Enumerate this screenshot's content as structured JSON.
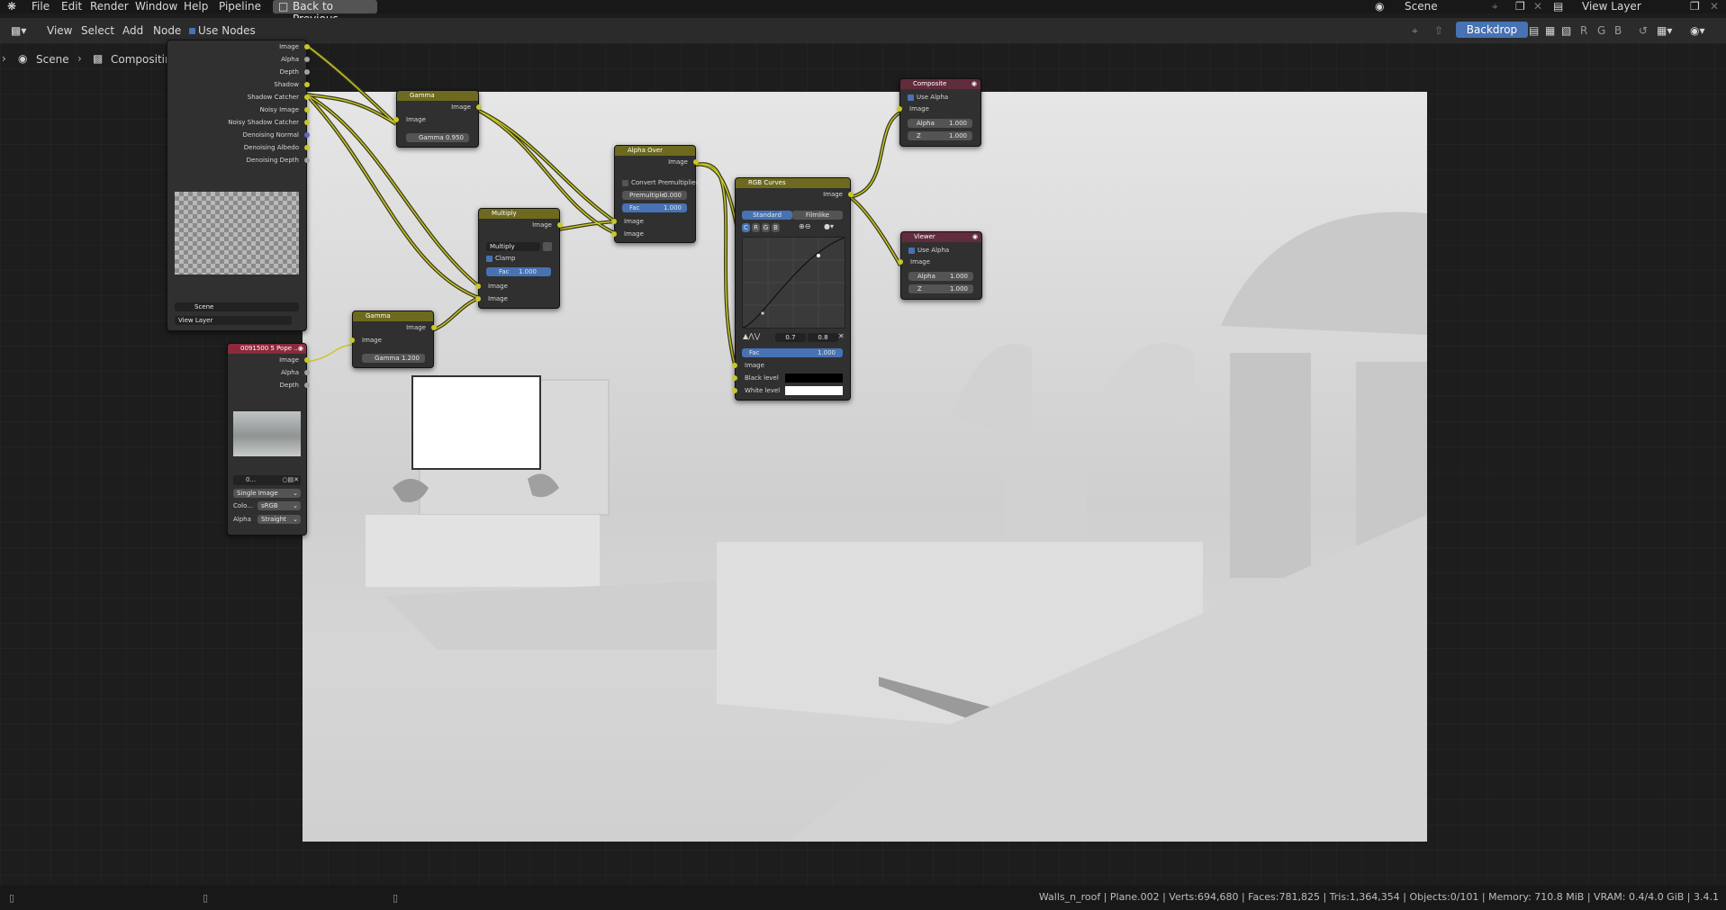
{
  "menu": {
    "items": [
      "File",
      "Edit",
      "Render",
      "Window",
      "Help",
      "Pipeline"
    ],
    "back_button": "Back to Previous",
    "scene_name": "Scene",
    "view_layer": "View Layer"
  },
  "header": {
    "items": [
      "View",
      "Select",
      "Add",
      "Node"
    ],
    "use_nodes": "Use Nodes",
    "backdrop": "Backdrop",
    "channels": [
      "R",
      "G",
      "B"
    ]
  },
  "breadcrumb": {
    "scene": "Scene",
    "tree": "Compositing Nodetree"
  },
  "render_layers": {
    "outputs": [
      "Image",
      "Alpha",
      "Depth",
      "Shadow",
      "Shadow Catcher",
      "Noisy Image",
      "Noisy Shadow Catcher",
      "Denoising Normal",
      "Denoising Albedo",
      "Denoising Depth"
    ],
    "scene_field": "Scene",
    "layer_field": "View Layer"
  },
  "gamma1": {
    "title": "Gamma",
    "out": "Image",
    "in": "Image",
    "label": "Gamma",
    "value": "0.950"
  },
  "gamma2": {
    "title": "Gamma",
    "out": "Image",
    "in": "Image",
    "label": "Gamma",
    "value": "1.200"
  },
  "multiply": {
    "title": "Multiply",
    "out": "Image",
    "mode": "Multiply",
    "clamp": "Clamp",
    "fac_label": "Fac",
    "fac": "1.000",
    "in1": "Image",
    "in2": "Image"
  },
  "alpha_over": {
    "title": "Alpha Over",
    "out": "Image",
    "convert": "Convert Premultiplied",
    "premul_label": "Premultiple",
    "premul": "0.000",
    "fac_label": "Fac",
    "fac": "1.000",
    "in1": "Image",
    "in2": "Image"
  },
  "rgb_curves": {
    "title": "RGB Curves",
    "out": "Image",
    "tab_standard": "Standard",
    "tab_filmlike": "Filmlike",
    "channels": [
      "C",
      "R",
      "G",
      "B"
    ],
    "point_x": "0.7",
    "point_y": "0.8",
    "fac_label": "Fac",
    "fac": "1.000",
    "in": "Image",
    "black": "Black level",
    "white": "White level"
  },
  "composite": {
    "title": "Composite",
    "use_alpha": "Use Alpha",
    "in": "Image",
    "alpha_label": "Alpha",
    "alpha": "1.000",
    "z_label": "Z",
    "z": "1.000"
  },
  "viewer": {
    "title": "Viewer",
    "use_alpha": "Use Alpha",
    "in": "Image",
    "alpha_label": "Alpha",
    "alpha": "1.000",
    "z_label": "Z",
    "z": "1.000"
  },
  "image_node": {
    "title": "0091500 5 Pope ...",
    "outputs": [
      "Image",
      "Alpha",
      "Depth"
    ],
    "file": "0...",
    "source": "Single Image",
    "color_label": "Colo...",
    "color_space": "sRGB",
    "alpha_label": "Alpha",
    "alpha_mode": "Straight"
  },
  "status": "Walls_n_roof | Plane.002 | Verts:694,680 | Faces:781,825 | Tris:1,364,354 | Objects:0/101 | Memory: 710.8 MiB | VRAM: 0.4/4.0 GiB | 3.4.1"
}
